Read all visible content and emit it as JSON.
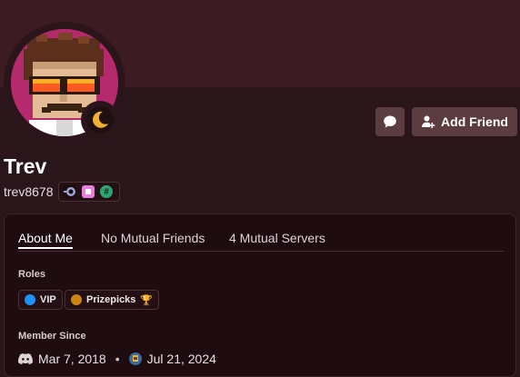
{
  "profile": {
    "display_name": "Trev",
    "username": "trev8678",
    "status": "idle"
  },
  "actions": {
    "message_icon": "message-bubble-icon",
    "add_friend_label": "Add Friend"
  },
  "badges": [
    "nitro-badge-icon",
    "booster-badge-icon",
    "hashtag-badge-icon"
  ],
  "tabs": [
    {
      "label": "About Me",
      "active": true
    },
    {
      "label": "No Mutual Friends",
      "active": false
    },
    {
      "label": "4 Mutual Servers",
      "active": false
    }
  ],
  "roles": {
    "heading": "Roles",
    "items": [
      {
        "label": "VIP",
        "color": "#1e90ff",
        "emoji": ""
      },
      {
        "label": "Prizepicks",
        "color": "#c98412",
        "emoji": "🏆"
      }
    ]
  },
  "member_since": {
    "heading": "Member Since",
    "discord_date": "Mar 7, 2018",
    "server_date": "Jul 21, 2024"
  },
  "colors": {
    "banner": "#3d1b22",
    "background": "#2a151b",
    "button": "#5b3c3f",
    "avatar_bg": "#b42a6d"
  }
}
